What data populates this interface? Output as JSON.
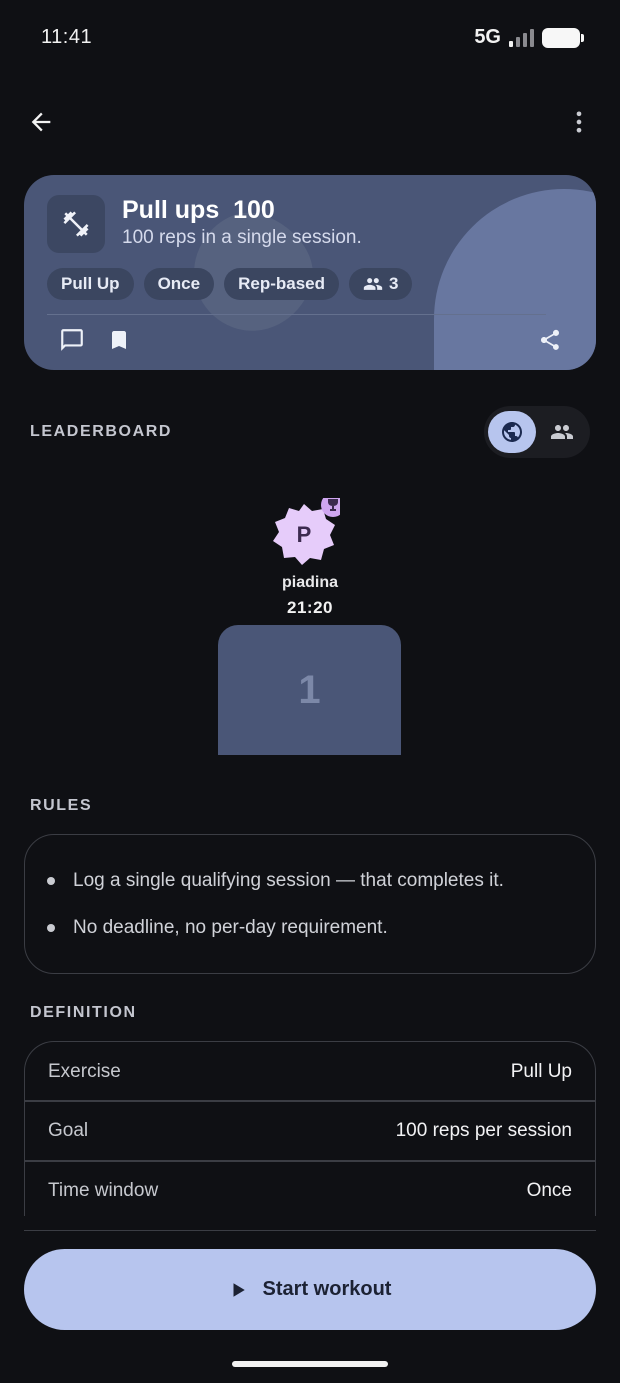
{
  "status_bar": {
    "time": "11:41",
    "network": "5G"
  },
  "top_bar": {
    "back_icon": "arrow-left-icon",
    "menu_icon": "more-vert-icon"
  },
  "challenge": {
    "icon": "dumbbell-icon",
    "title": "Pull ups  100",
    "subtitle": "100 reps in a single session.",
    "chips": {
      "exercise": "Pull Up",
      "frequency": "Once",
      "type": "Rep-based",
      "participants": "3"
    },
    "actions": {
      "comment_icon": "comment-icon",
      "bookmark_icon": "bookmark-icon",
      "share_icon": "share-icon"
    },
    "accent": "#4a5677"
  },
  "leaderboard": {
    "label": "LEADERBOARD",
    "toggle": {
      "global_icon": "globe-icon",
      "friends_icon": "group-icon",
      "selected": "global"
    },
    "podium": {
      "initial": "P",
      "name": "piadina",
      "score": "21:20",
      "rank": "1"
    }
  },
  "rules": {
    "label": "RULES",
    "items": [
      "Log a single qualifying session — that completes it.",
      "No deadline, no per-day requirement."
    ]
  },
  "definition": {
    "label": "DEFINITION",
    "rows": [
      {
        "key": "Exercise",
        "value": "Pull Up"
      },
      {
        "key": "Goal",
        "value": "100 reps per session"
      },
      {
        "key": "Time window",
        "value": "Once"
      }
    ]
  },
  "cta": {
    "label": "Start workout",
    "icon": "play-icon",
    "color": "#b7c5ee"
  }
}
